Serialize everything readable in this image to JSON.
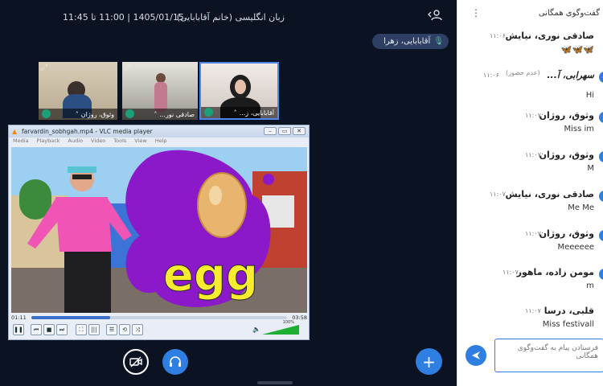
{
  "header": {
    "title": "زبان انگلیسی (خانم آقابابایی)",
    "datetime": "1405/01/15 | 11:00 تا 11:45"
  },
  "speaker": {
    "name": "آقابابایی، زهرا"
  },
  "tiles": [
    {
      "name": "وثوق، روژان"
    },
    {
      "name": "صادقی نور..."
    },
    {
      "name": "آقابابایی، ز..."
    }
  ],
  "vlc": {
    "title": "farvardin_sobhgah.mp4 - VLC media player",
    "menu": [
      "Media",
      "Playback",
      "Audio",
      "Video",
      "Tools",
      "View",
      "Help"
    ],
    "elapsed": "01:11",
    "total": "03:58",
    "progress": 0.31,
    "volume_label": "100%",
    "video_word": "egg"
  },
  "chat": {
    "title": "گفت‌وگوی همگانی",
    "messages": [
      {
        "sender": "صادقی نوری، نیایش",
        "time": "۱۱:۰۶",
        "text": "🦋🦋🦋"
      },
      {
        "sender": "سهرابی، آ...",
        "time": "۱۱:۰۶",
        "note": "(عدم حضور)",
        "text": "Hi"
      },
      {
        "sender": "وثوق، روژان",
        "time": "۱۱:۰۷",
        "text": "Miss im"
      },
      {
        "sender": "وثوق، روژان",
        "time": "۱۱:۰۷",
        "text": "M"
      },
      {
        "sender": "صادقی نوری، نیایش",
        "time": "۱۱:۰۷",
        "text": "Me Me"
      },
      {
        "sender": "وثوق، روژان",
        "time": "۱۱:۰۷",
        "text": "Meeeeee"
      },
      {
        "sender": "مومن زاده، ماهور",
        "time": "۱۱:۰۷",
        "text": "m"
      },
      {
        "sender": "قلبی، درسا",
        "time": "۱۱:۰۷",
        "text": "Miss festivall"
      }
    ],
    "composer_placeholder": "فرستادن پیام به گفت‌وگوی همگانی"
  },
  "colors": {
    "stage_bg": "#0b1322",
    "accent": "#2f7fe2",
    "pill_bg": "#2f3f63"
  }
}
